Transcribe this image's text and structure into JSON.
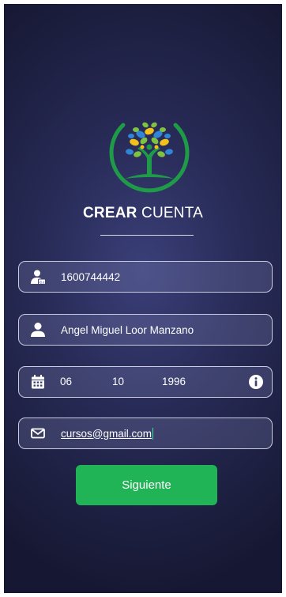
{
  "header": {
    "title_bold": "CREAR",
    "title_rest": " CUENTA",
    "logo_icon": "tree-logo-icon"
  },
  "form": {
    "id_number": {
      "value": "1600744442",
      "icon": "id-card-user-icon"
    },
    "full_name": {
      "value": "Angel Miguel Loor Manzano",
      "icon": "user-icon"
    },
    "birth_date": {
      "day": "06",
      "month": "10",
      "year": "1996",
      "icon": "calendar-icon",
      "info_icon": "info-icon"
    },
    "email": {
      "value": "cursos@gmail.com",
      "icon": "envelope-icon"
    }
  },
  "actions": {
    "next_label": "Siguiente"
  },
  "colors": {
    "background": "#272a55",
    "accent_green": "#20b456",
    "field_border": "#c9cbe0",
    "text": "#ffffff"
  }
}
